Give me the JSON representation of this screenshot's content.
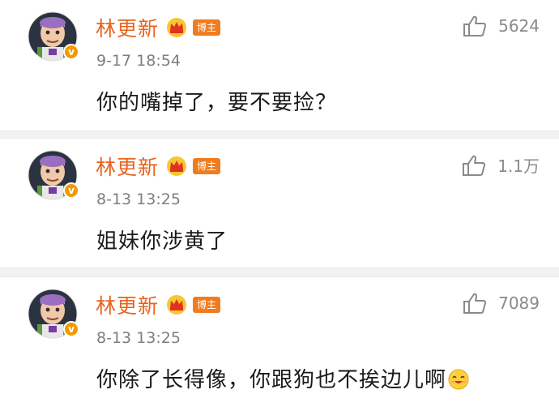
{
  "colors": {
    "username": "#e8631e",
    "badge": "#f07c20",
    "divider": "#f2f2f2",
    "timestamp": "#7e7e7e",
    "like": "#8a8a8a"
  },
  "comments": [
    {
      "username": "林更新",
      "badge": "博主",
      "time": "9-17 18:54",
      "text": "你的嘴掉了，要不要捡？",
      "likes": "5624",
      "icons": [
        "avatar",
        "verified-icon",
        "crown-icon",
        "thumbs-up-icon"
      ]
    },
    {
      "username": "林更新",
      "badge": "博主",
      "time": "8-13 13:25",
      "text": "姐妹你涉黄了",
      "likes": "1.1万",
      "icons": [
        "avatar",
        "verified-icon",
        "crown-icon",
        "thumbs-up-icon"
      ]
    },
    {
      "username": "林更新",
      "badge": "博主",
      "time": "8-13 13:25",
      "text": "你除了长得像，你跟狗也不挨边儿啊",
      "likes": "7089",
      "icons": [
        "avatar",
        "verified-icon",
        "crown-icon",
        "thumbs-up-icon",
        "smile-emoji-icon"
      ]
    }
  ]
}
